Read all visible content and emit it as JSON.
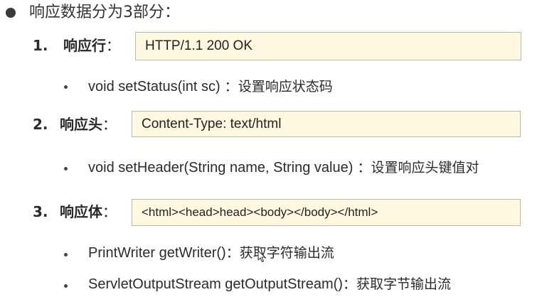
{
  "title": "响应数据分为3部分：",
  "sections": [
    {
      "number": "1.",
      "label": "响应行",
      "colon": "：",
      "example": "HTTP/1.1 200 OK",
      "methods": [
        {
          "signature": "void setStatus(int sc)",
          "sep": "：",
          "desc": "设置响应状态码"
        }
      ]
    },
    {
      "number": "2.",
      "label": "响应头",
      "colon": "：",
      "example": "Content-Type: text/html",
      "methods": [
        {
          "signature": "void setHeader(String name, String value)",
          "sep": "：",
          "desc": "设置响应头键值对"
        }
      ]
    },
    {
      "number": "3.",
      "label": "响应体",
      "colon": "：",
      "example": "<html><head>head><body></body></html>",
      "methods": [
        {
          "signature": "PrintWriter getWriter()",
          "sep": "：",
          "desc": "获取字符输出流"
        },
        {
          "signature": "ServletOutputStream getOutputStream()",
          "sep": "：",
          "desc": "获取字节输出流"
        }
      ]
    }
  ],
  "colors": {
    "box_background": "#fff8e1",
    "box_border": "#bdb9ab",
    "text": "#2b2b2b"
  },
  "icons": {
    "bullet": "filled-circle",
    "cursor": "mouse-pointer-icon"
  }
}
